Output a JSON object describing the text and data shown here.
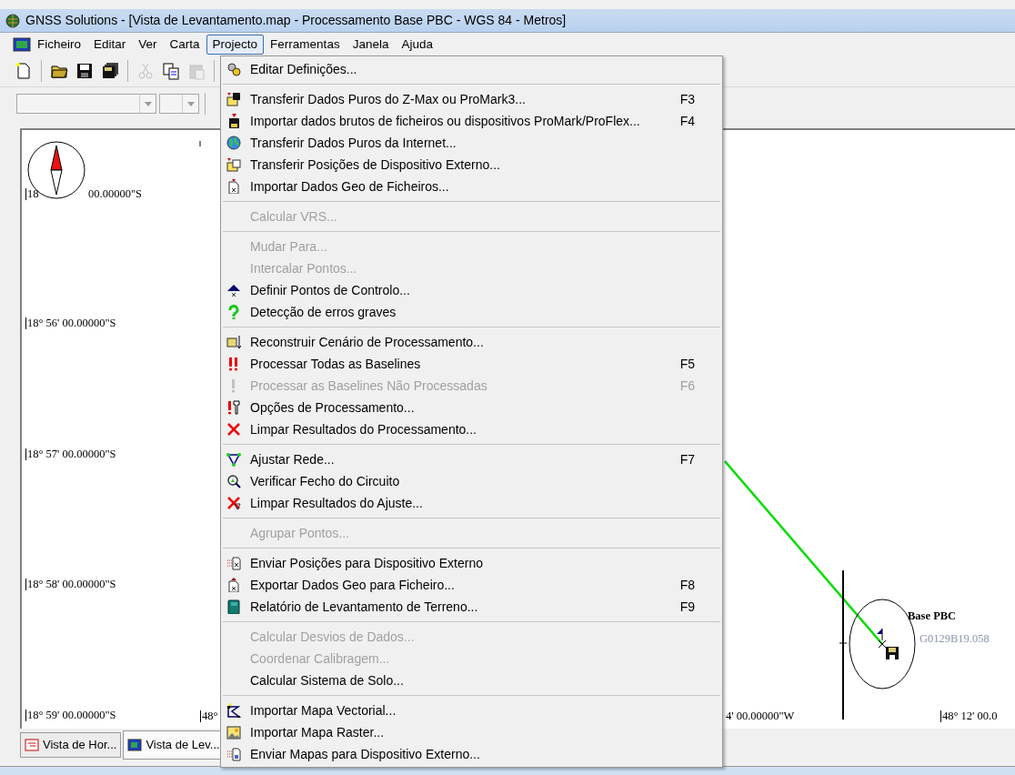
{
  "window": {
    "title": "GNSS Solutions - [Vista de Levantamento.map - Processamento Base PBC - WGS 84 - Metros]"
  },
  "menu_bar": [
    {
      "label": "Ficheiro",
      "selected": false
    },
    {
      "label": "Editar",
      "selected": false
    },
    {
      "label": "Ver",
      "selected": false
    },
    {
      "label": "Carta",
      "selected": false
    },
    {
      "label": "Projecto",
      "selected": true
    },
    {
      "label": "Ferramentas",
      "selected": false
    },
    {
      "label": "Janela",
      "selected": false
    },
    {
      "label": "Ajuda",
      "selected": false
    }
  ],
  "toolbar": [
    {
      "disabled": false
    },
    {
      "disabled": false
    },
    {
      "disabled": false
    },
    {
      "disabled": false
    },
    {
      "disabled": true
    },
    {
      "disabled": false
    },
    {
      "disabled": true
    }
  ],
  "project_menu": [
    {
      "kind": "item",
      "label": "Editar Definições...",
      "disabled": false
    },
    {
      "kind": "separator"
    },
    {
      "kind": "item",
      "label": "Transferir Dados Puros do Z-Max ou ProMark3...",
      "shortcut": "F3",
      "disabled": false
    },
    {
      "kind": "item",
      "label": "Importar dados brutos de ficheiros ou dispositivos ProMark/ProFlex...",
      "shortcut": "F4",
      "disabled": false
    },
    {
      "kind": "item",
      "label": "Transferir Dados Puros da Internet...",
      "disabled": false
    },
    {
      "kind": "item",
      "label": "Transferir Posições de Dispositivo Externo...",
      "disabled": false
    },
    {
      "kind": "item",
      "label": "Importar Dados Geo de Ficheiros...",
      "disabled": false
    },
    {
      "kind": "separator"
    },
    {
      "kind": "item",
      "label": "Calcular VRS...",
      "disabled": true
    },
    {
      "kind": "separator"
    },
    {
      "kind": "item",
      "label": "Mudar Para...",
      "disabled": true
    },
    {
      "kind": "item",
      "label": "Intercalar Pontos...",
      "disabled": true
    },
    {
      "kind": "item",
      "label": "Definir Pontos de Controlo...",
      "disabled": false
    },
    {
      "kind": "item",
      "label": "Detecção de erros graves",
      "disabled": false
    },
    {
      "kind": "separator"
    },
    {
      "kind": "item",
      "label": "Reconstruir Cenário de Processamento...",
      "disabled": false
    },
    {
      "kind": "item",
      "label": "Processar Todas as Baselines",
      "shortcut": "F5",
      "disabled": false
    },
    {
      "kind": "item",
      "label": "Processar as Baselines Não Processadas",
      "shortcut": "F6",
      "disabled": true
    },
    {
      "kind": "item",
      "label": "Opções de Processamento...",
      "disabled": false
    },
    {
      "kind": "item",
      "label": "Limpar Resultados do Processamento...",
      "disabled": false
    },
    {
      "kind": "separator"
    },
    {
      "kind": "item",
      "label": "Ajustar Rede...",
      "shortcut": "F7",
      "disabled": false
    },
    {
      "kind": "item",
      "label": "Verificar Fecho do Circuito",
      "disabled": false
    },
    {
      "kind": "item",
      "label": "Limpar Resultados do Ajuste...",
      "disabled": false
    },
    {
      "kind": "separator"
    },
    {
      "kind": "item",
      "label": "Agrupar Pontos...",
      "disabled": true
    },
    {
      "kind": "separator"
    },
    {
      "kind": "item",
      "label": "Enviar Posições para Dispositivo Externo",
      "disabled": false
    },
    {
      "kind": "item",
      "label": "Exportar Dados Geo para Ficheiro...",
      "shortcut": "F8",
      "disabled": false
    },
    {
      "kind": "item",
      "label": "Relatório de Levantamento de Terreno...",
      "shortcut": "F9",
      "disabled": false
    },
    {
      "kind": "separator"
    },
    {
      "kind": "item",
      "label": "Calcular Desvios de Dados...",
      "disabled": true
    },
    {
      "kind": "item",
      "label": "Coordenar Calibragem...",
      "disabled": true
    },
    {
      "kind": "item",
      "label": "Calcular Sistema de Solo...",
      "disabled": false
    },
    {
      "kind": "separator"
    },
    {
      "kind": "item",
      "label": "Importar Mapa Vectorial...",
      "disabled": false
    },
    {
      "kind": "item",
      "label": "Importar Mapa Raster...",
      "disabled": false
    },
    {
      "kind": "item",
      "label": "Enviar Mapas para Dispositivo Externo...",
      "disabled": false
    }
  ],
  "map": {
    "lat_labels": [
      {
        "text": "18",
        "after_compass": "00.00000\"S"
      },
      {
        "text": "18° 56' 00.00000\"S"
      },
      {
        "text": "18° 57' 00.00000\"S"
      },
      {
        "text": "18° 58' 00.00000\"S"
      },
      {
        "text": "18° 59' 00.00000\"S"
      }
    ],
    "lon_labels": [
      {
        "text": "48°"
      },
      {
        "text": "4' 00.00000\"W"
      },
      {
        "text": "48° 12' 00.0"
      }
    ],
    "station": {
      "name": "Base PBC",
      "file": "G0129B19.058"
    }
  },
  "tabs": [
    {
      "label": "Vista de Hor...",
      "selected": false
    },
    {
      "label": "Vista de Lev...",
      "selected": true
    }
  ]
}
